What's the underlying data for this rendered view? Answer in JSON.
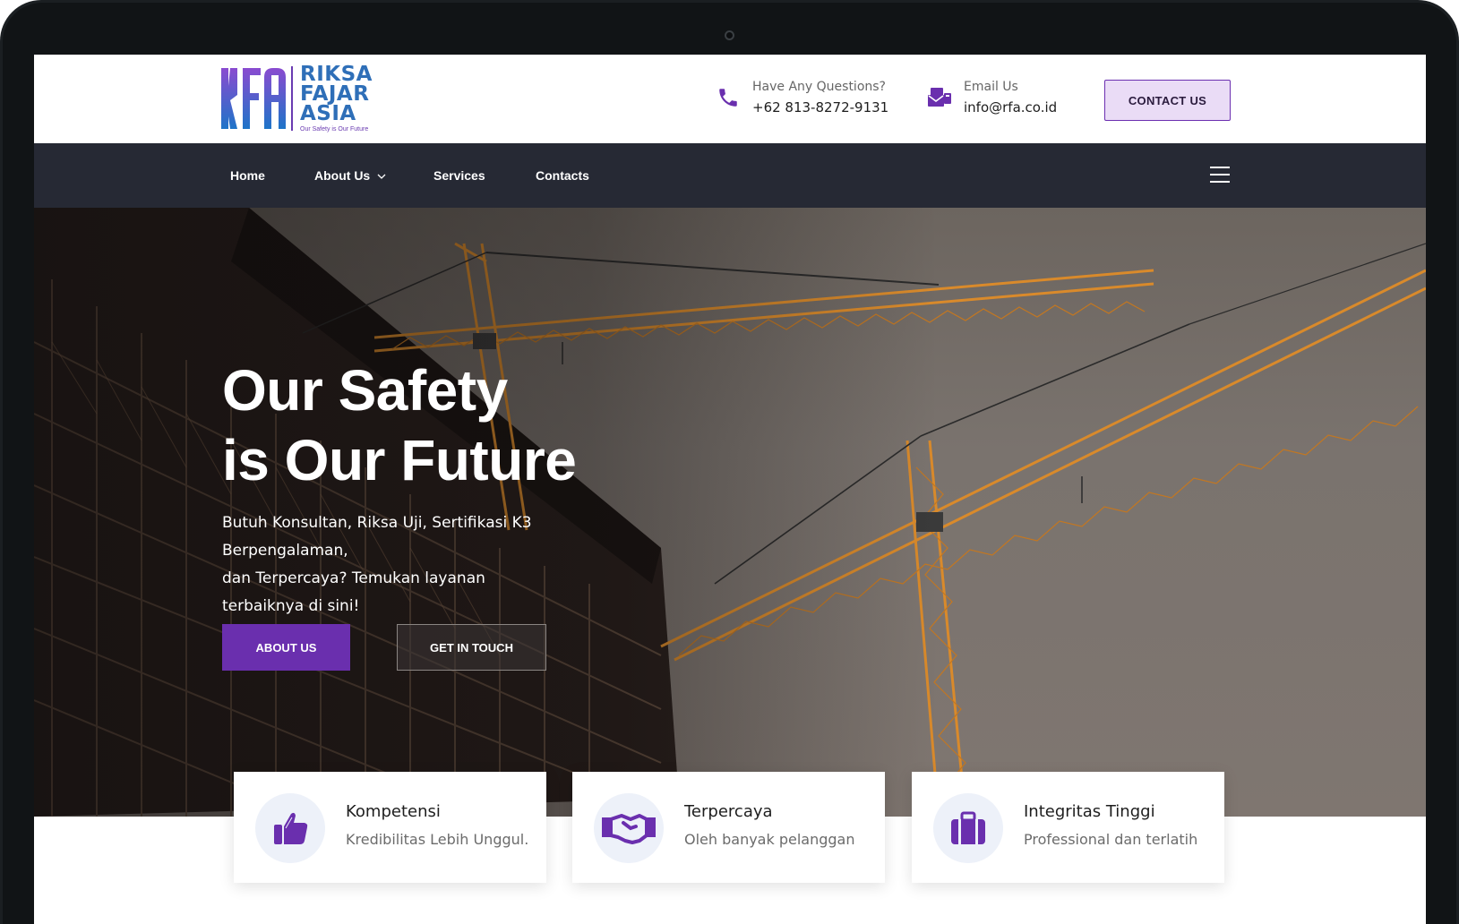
{
  "header": {
    "logo_words": [
      "RIKSA",
      "FAJAR",
      "ASIA"
    ],
    "logo_tagline": "Our Safety is Our Future",
    "phone_label": "Have Any Questions?",
    "phone_value": "+62 813-8272-9131",
    "email_label": "Email Us",
    "email_value": "info@rfa.co.id",
    "contact_button": "CONTACT US"
  },
  "nav": {
    "items": [
      {
        "label": "Home"
      },
      {
        "label": "About Us"
      },
      {
        "label": "Services"
      },
      {
        "label": "Contacts"
      }
    ]
  },
  "hero": {
    "title_line1": "Our Safety",
    "title_line2": "is Our Future",
    "subtitle_line1": "Butuh Konsultan, Riksa Uji, Sertifikasi K3 Berpengalaman,",
    "subtitle_line2": "dan Terpercaya? Temukan layanan",
    "subtitle_line3": "terbaiknya di sini!",
    "primary_button": "ABOUT US",
    "secondary_button": "GET IN TOUCH"
  },
  "features": [
    {
      "title": "Kompetensi",
      "text": "Kredibilitas Lebih Unggul.",
      "icon": "thumbs-up-icon"
    },
    {
      "title": "Terpercaya",
      "text": "Oleh banyak pelanggan",
      "icon": "handshake-icon"
    },
    {
      "title": "Integritas Tinggi",
      "text": "Professional dan terlatih",
      "icon": "briefcase-icon"
    }
  ],
  "colors": {
    "accent": "#6a2fae",
    "nav_bg": "#262934",
    "brand_blue": "#2f6fb8"
  }
}
